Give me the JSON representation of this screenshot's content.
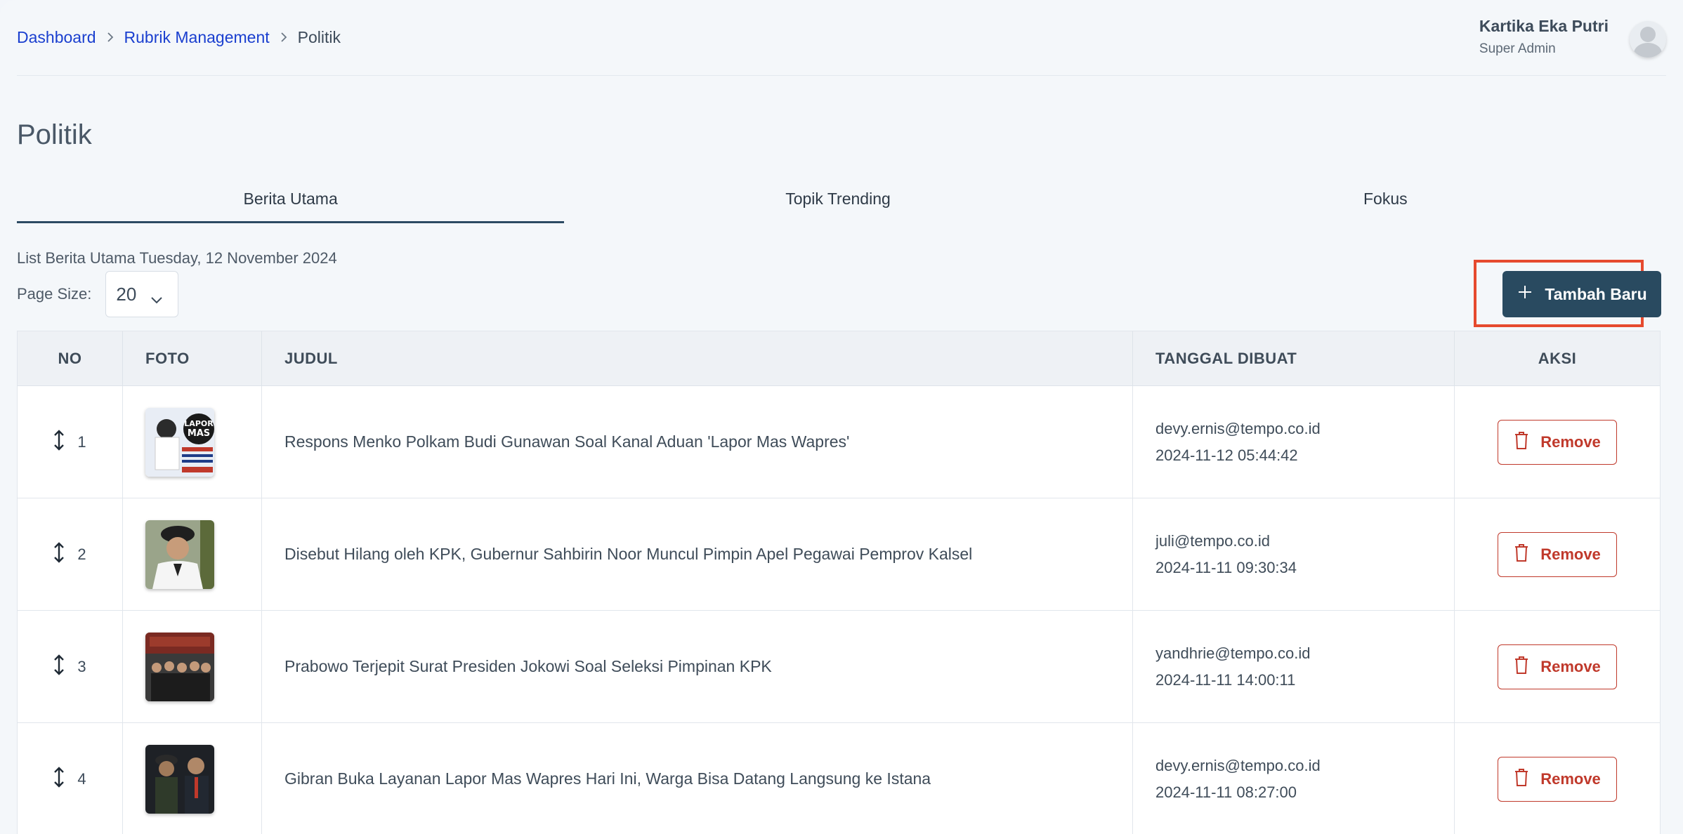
{
  "breadcrumb": {
    "items": [
      {
        "label": "Dashboard"
      },
      {
        "label": "Rubrik Management"
      },
      {
        "label": "Politik"
      }
    ]
  },
  "user": {
    "name": "Kartika Eka Putri",
    "role": "Super Admin"
  },
  "page": {
    "title": "Politik"
  },
  "tabs": [
    {
      "label": "Berita Utama",
      "active": true
    },
    {
      "label": "Topik Trending",
      "active": false
    },
    {
      "label": "Fokus",
      "active": false
    }
  ],
  "list": {
    "label": "List Berita Utama Tuesday, 12 November 2024",
    "page_size_label": "Page Size:",
    "page_size_value": "20",
    "add_button_label": "Tambah Baru"
  },
  "table": {
    "headers": {
      "no": "NO",
      "foto": "FOTO",
      "judul": "JUDUL",
      "tanggal": "TANGGAL DIBUAT",
      "aksi": "AKSI"
    },
    "rows": [
      {
        "no": "1",
        "judul": "Respons Menko Polkam Budi Gunawan Soal Kanal Aduan 'Lapor Mas Wapres'",
        "email": "devy.ernis@tempo.co.id",
        "date": "2024-11-12 05:44:42",
        "action": "Remove"
      },
      {
        "no": "2",
        "judul": "Disebut Hilang oleh KPK, Gubernur Sahbirin Noor Muncul Pimpin Apel Pegawai Pemprov Kalsel",
        "email": "juli@tempo.co.id",
        "date": "2024-11-11 09:30:34",
        "action": "Remove"
      },
      {
        "no": "3",
        "judul": "Prabowo Terjepit Surat Presiden Jokowi Soal Seleksi Pimpinan KPK",
        "email": "yandhrie@tempo.co.id",
        "date": "2024-11-11 14:00:11",
        "action": "Remove"
      },
      {
        "no": "4",
        "judul": "Gibran Buka Layanan Lapor Mas Wapres Hari Ini, Warga Bisa Datang Langsung ke Istana",
        "email": "devy.ernis@tempo.co.id",
        "date": "2024-11-11 08:27:00",
        "action": "Remove"
      }
    ]
  },
  "colors": {
    "accent": "#294a60",
    "link": "#1a3fcf",
    "danger": "#c0392b",
    "highlight": "#e64a2e"
  }
}
